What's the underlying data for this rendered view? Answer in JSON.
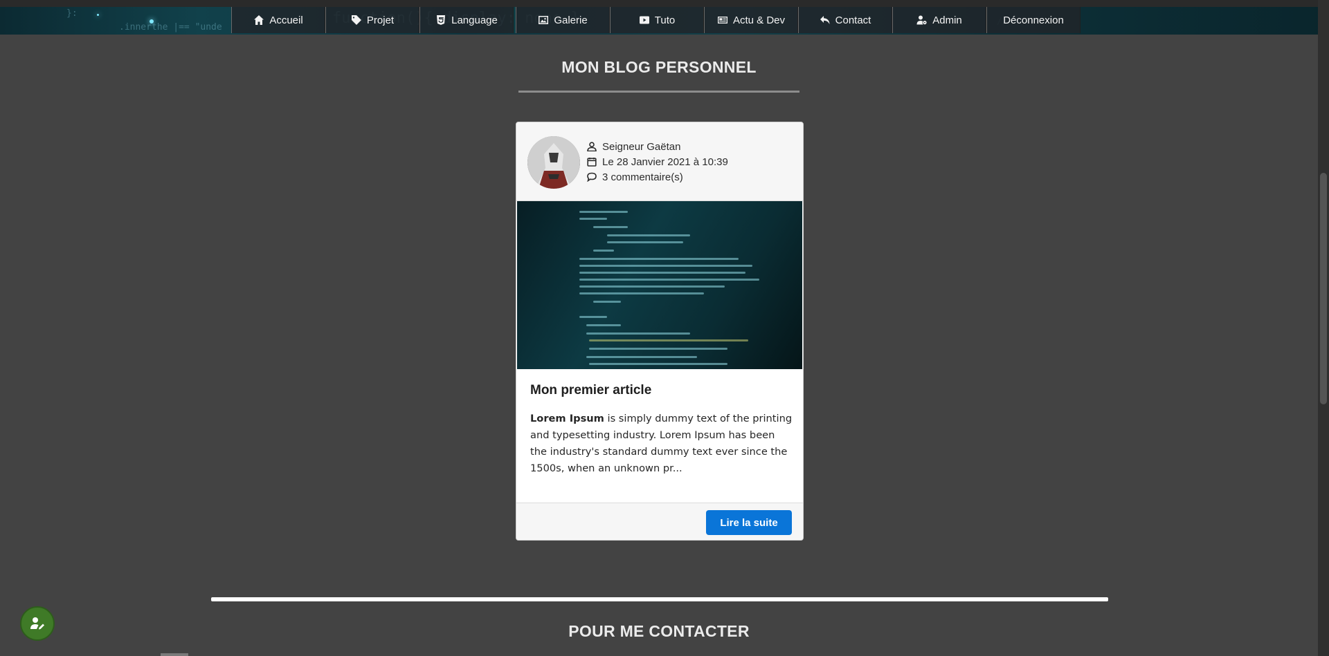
{
  "nav": {
    "items": [
      {
        "label": "Accueil",
        "icon": "home-icon"
      },
      {
        "label": "Projet",
        "icon": "tag-icon"
      },
      {
        "label": "Language",
        "icon": "html5-icon"
      },
      {
        "label": "Galerie",
        "icon": "image-icon"
      },
      {
        "label": "Tuto",
        "icon": "youtube-icon"
      },
      {
        "label": "Actu & Dev",
        "icon": "newspaper-icon"
      },
      {
        "label": "Contact",
        "icon": "reply-icon"
      },
      {
        "label": "Admin",
        "icon": "user-cog-icon"
      },
      {
        "label": "Déconnexion",
        "icon": ""
      }
    ]
  },
  "blog": {
    "title": "MON BLOG PERSONNEL",
    "post": {
      "author": "Seigneur Gaëtan",
      "date": "Le 28 Janvier 2021 à 10:39",
      "comments": "3 commentaire(s)",
      "title": "Mon premier article",
      "excerpt_bold": "Lorem Ipsum",
      "excerpt_rest": " is simply dummy text of the printing and typesetting industry. Lorem Ipsum has been the industry's standard dummy text ever since the 1500s, when an unknown pr...",
      "read_more": "Lire la suite"
    }
  },
  "contact": {
    "title": "POUR ME CONTACTER"
  },
  "colors": {
    "background": "#434343",
    "button": "#0a75d8",
    "fab": "#3f7a27"
  }
}
